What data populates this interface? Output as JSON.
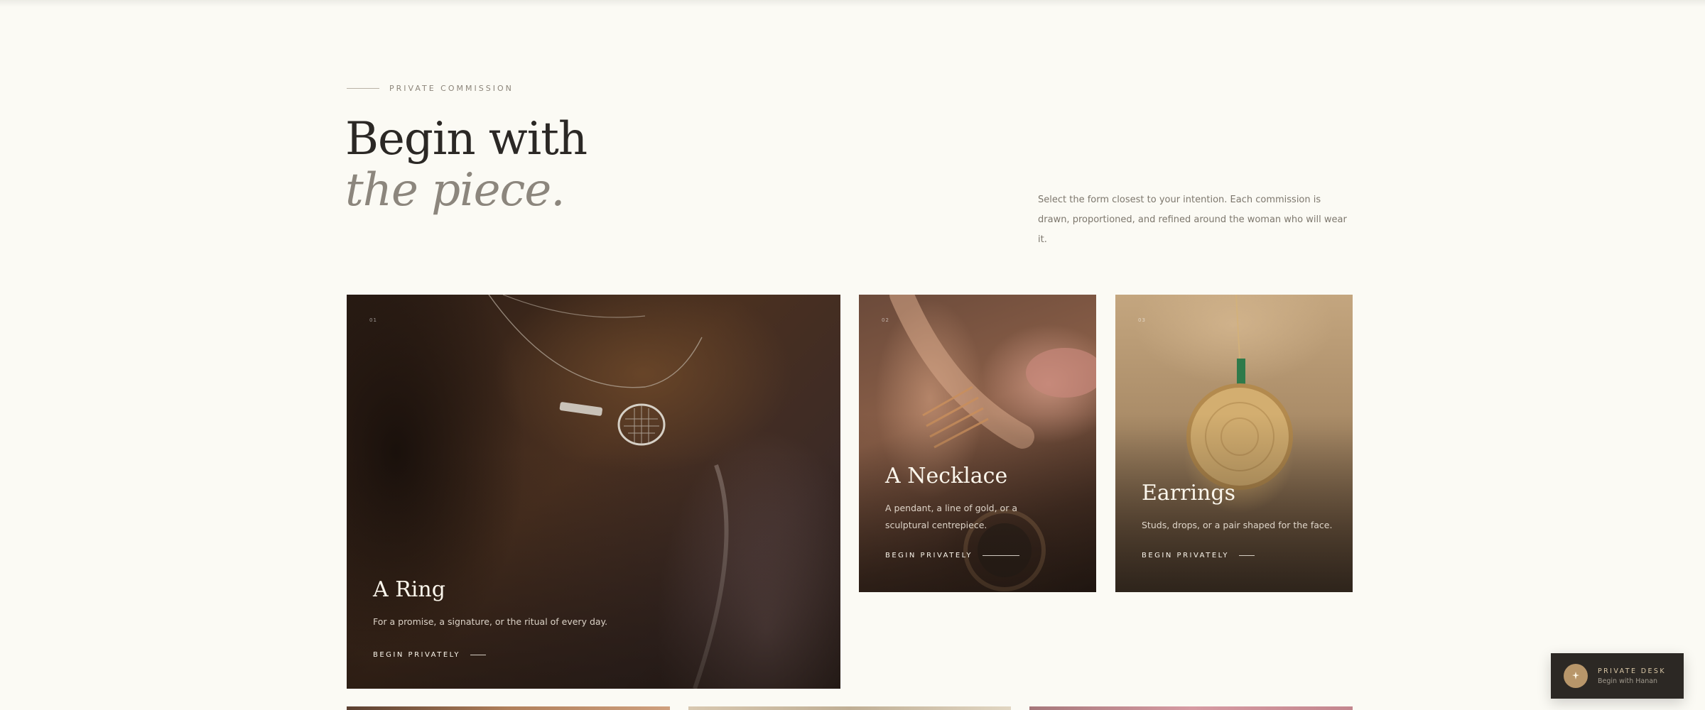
{
  "section": {
    "eyebrow": "PRIVATE COMMISSION",
    "headline_line1": "Begin with",
    "headline_line2": "the piece.",
    "intro": "Select the form closest to your intention. Each commission is drawn, proportioned, and refined around the woman who will wear it."
  },
  "cards": [
    {
      "index": "01",
      "title": "A Ring",
      "description": "For a promise, a signature, or the ritual of every day.",
      "cta": "BEGIN PRIVATELY"
    },
    {
      "index": "02",
      "title": "A Necklace",
      "description": "A pendant, a line of gold, or a sculptural centrepiece.",
      "cta": "BEGIN PRIVATELY"
    },
    {
      "index": "03",
      "title": "Earrings",
      "description": "Studs, drops, or a pair shaped for the face.",
      "cta": "BEGIN PRIVATELY"
    }
  ],
  "desk": {
    "title": "PRIVATE DESK",
    "subtitle": "Begin with Hanan",
    "icon": "sparkle-pin-icon"
  },
  "colors": {
    "background": "#fbfaf4",
    "accent_gold": "#b8966a",
    "desk_bg": "#2c2824"
  }
}
